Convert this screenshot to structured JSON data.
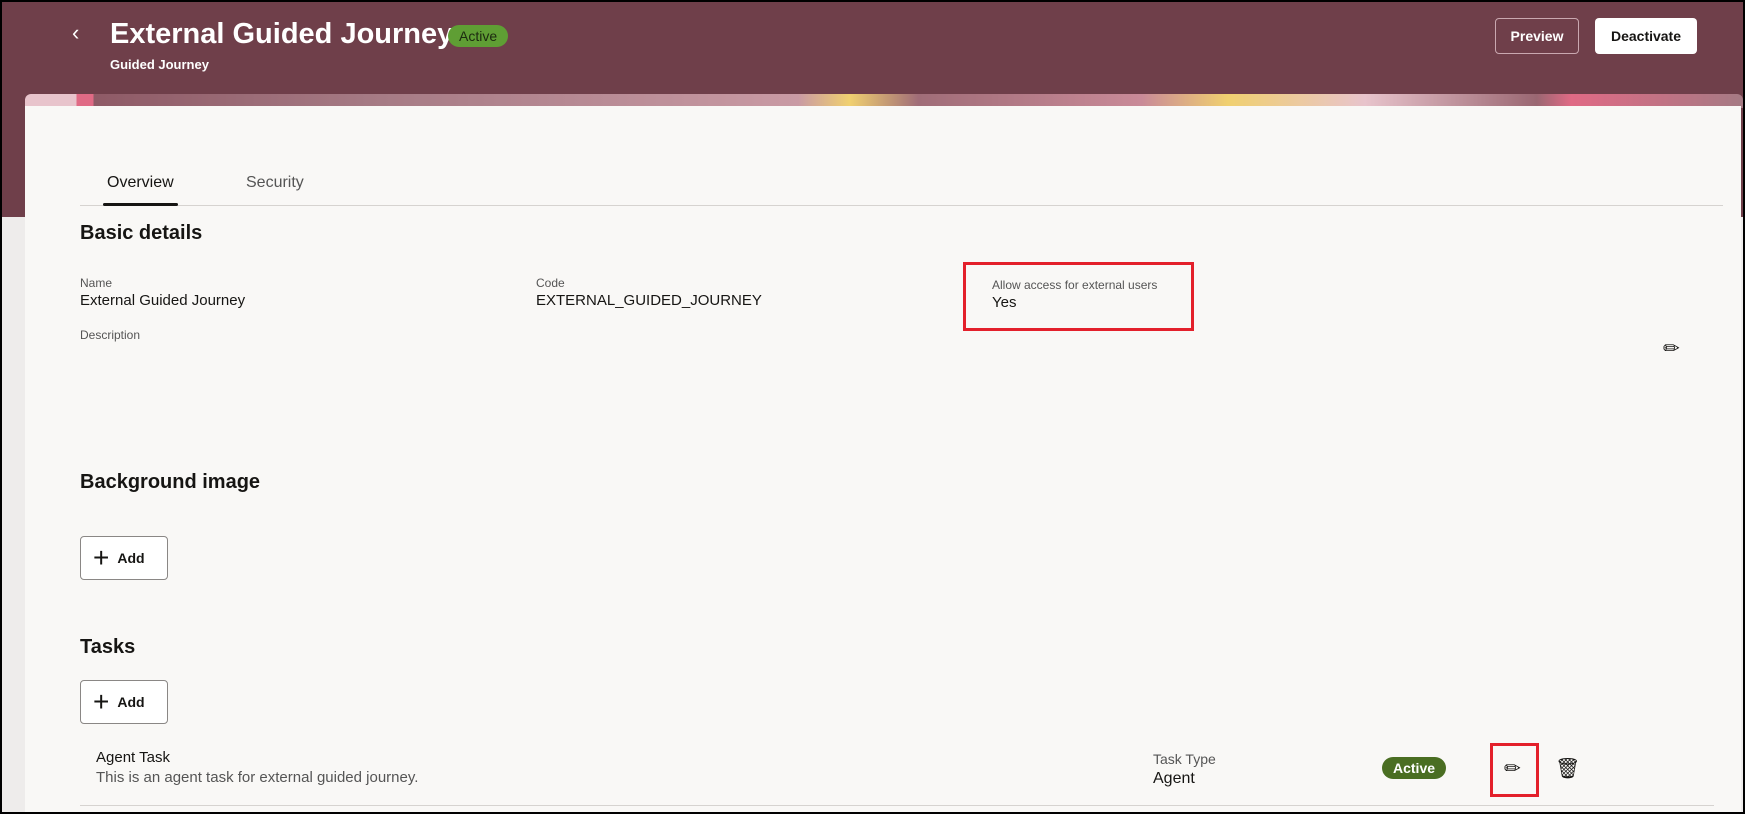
{
  "header": {
    "back_icon": "chevron-left-icon",
    "title": "External Guided Journey",
    "status": "Active",
    "subtitle": "Guided Journey",
    "preview": "Preview",
    "deactivate": "Deactivate"
  },
  "tabs": [
    "Overview",
    "Security"
  ],
  "basic": {
    "heading": "Basic details",
    "name_label": "Name",
    "name": "External Guided Journey",
    "code_label": "Code",
    "code": "EXTERNAL_GUIDED_JOURNEY",
    "access_label": "Allow access for external users",
    "access": "Yes",
    "description_label": "Description"
  },
  "background": {
    "heading": "Background image",
    "add": "Add"
  },
  "tasks": {
    "heading": "Tasks",
    "add": "Add",
    "items": [
      {
        "name": "Agent Task",
        "description": "This is an agent task for external guided journey.",
        "type_label": "Task Type",
        "type": "Agent",
        "status": "Active"
      }
    ]
  },
  "colors": {
    "header": "#6f3f4a",
    "active_badge": "#4a6e22",
    "highlight": "#e3202b"
  }
}
